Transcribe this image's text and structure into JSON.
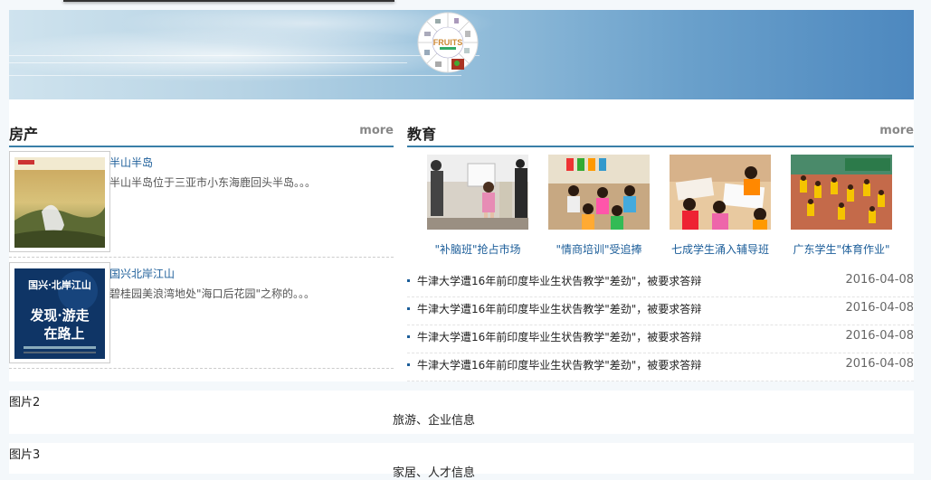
{
  "banner": {
    "logo_text": "FRUITS"
  },
  "housing": {
    "title": "房产",
    "more": "more",
    "items": [
      {
        "name": "半山半岛",
        "desc": "半山半岛位于三亚市小东海鹿回头半岛。。。"
      },
      {
        "name": "国兴北岸江山",
        "desc": "碧桂园美浪湾地处\"海口后花园\"之称的。。。",
        "poster_title": "国兴·北岸江山",
        "poster_slogan_1": "发现·游走",
        "poster_slogan_2": "在路上"
      }
    ]
  },
  "education": {
    "title": "教育",
    "more": "more",
    "pictures": [
      {
        "caption": "\"补脑班\"抢占市场"
      },
      {
        "caption": "\"情商培训\"受追捧"
      },
      {
        "caption": "七成学生涌入辅导班"
      },
      {
        "caption": "广东学生\"体育作业\""
      }
    ],
    "news": [
      {
        "title": "牛津大学遭16年前印度毕业生状告教学\"差劲\"，被要求答辩",
        "date": "2016-04-08"
      },
      {
        "title": "牛津大学遭16年前印度毕业生状告教学\"差劲\"，被要求答辩",
        "date": "2016-04-08"
      },
      {
        "title": "牛津大学遭16年前印度毕业生状告教学\"差劲\"，被要求答辩",
        "date": "2016-04-08"
      },
      {
        "title": "牛津大学遭16年前印度毕业生状告教学\"差劲\"，被要求答辩",
        "date": "2016-04-08"
      }
    ]
  },
  "blocks": [
    {
      "label": "图片2",
      "center_text": "旅游、企业信息"
    },
    {
      "label": "图片3",
      "center_text": "家居、人才信息"
    }
  ]
}
